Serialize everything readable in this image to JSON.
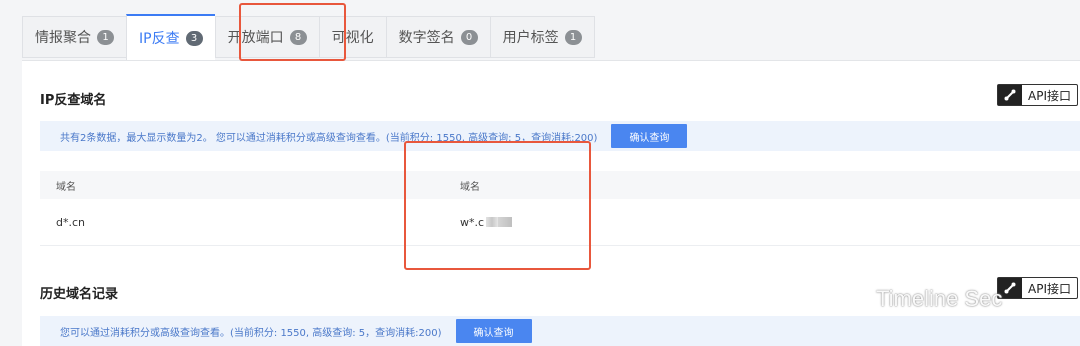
{
  "tabs": [
    {
      "label": "情报聚合",
      "count": "1",
      "active": false
    },
    {
      "label": "IP反查",
      "count": "3",
      "active": true
    },
    {
      "label": "开放端口",
      "count": "8",
      "active": false
    },
    {
      "label": "可视化",
      "count": "",
      "active": false
    },
    {
      "label": "数字签名",
      "count": "0",
      "active": false
    },
    {
      "label": "用户标签",
      "count": "1",
      "active": false
    }
  ],
  "ip_reverse": {
    "title": "IP反查域名",
    "api_label": "API接口",
    "info_text": "共有2条数据，最大显示数量为2。 您可以通过消耗积分或高级查询查看。(当前积分: 1550, 高级查询: 5，查询消耗:200)",
    "confirm_label": "确认查询",
    "columns": [
      "域名",
      "域名"
    ],
    "rows": [
      [
        "d*.cn",
        "w*.c"
      ]
    ]
  },
  "history": {
    "title": "历史域名记录",
    "api_label": "API接口",
    "info_text": "您可以通过消耗积分或高级查询查看。(当前积分: 1550, 高级查询: 5，查询消耗:200)",
    "confirm_label": "确认查询"
  },
  "watermark": {
    "text": "Timeline Sec",
    "icon": "wechat-icon"
  },
  "colors": {
    "accent": "#3b7bf4",
    "highlight": "#e8573c",
    "info_bg": "#edf3fc"
  }
}
